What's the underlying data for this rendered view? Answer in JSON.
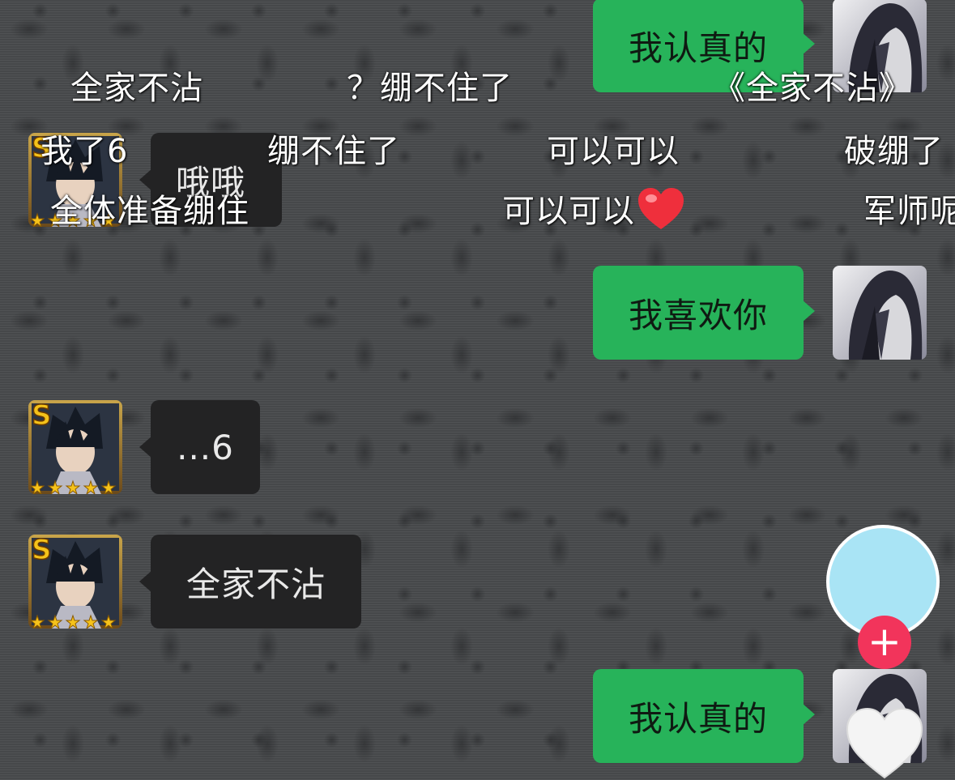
{
  "messages": [
    {
      "id": "m1",
      "side": "right",
      "text": "我认真的"
    },
    {
      "id": "m2",
      "side": "left",
      "text": "哦哦"
    },
    {
      "id": "m3",
      "side": "right",
      "text": "我喜欢你"
    },
    {
      "id": "m4",
      "side": "left",
      "text": "...6"
    },
    {
      "id": "m5",
      "side": "left",
      "text": "全家不沾"
    },
    {
      "id": "m6",
      "side": "right",
      "text": "我认真的"
    }
  ],
  "danmaku": {
    "row1": [
      "全家不沾",
      "？绷不住了",
      "《全家不沾》"
    ],
    "row2": [
      "我了6",
      "绷不住了",
      "可以可以",
      "破绷了"
    ],
    "row3": [
      "全体准备绷住",
      "可以可以",
      "军师呢"
    ]
  },
  "icons": {
    "left_avatar": "ninja-character-avatar-icon",
    "right_avatar": "hooded-character-avatar-icon",
    "follow": "plus-icon",
    "like": "heart-icon",
    "danmaku_heart": "red-heart-emoji-icon"
  },
  "colors": {
    "sent_bubble": "#27b35a",
    "received_bubble": "#232324",
    "follow_button": "#f2345b",
    "creator_avatar": "#a9e4f5"
  }
}
